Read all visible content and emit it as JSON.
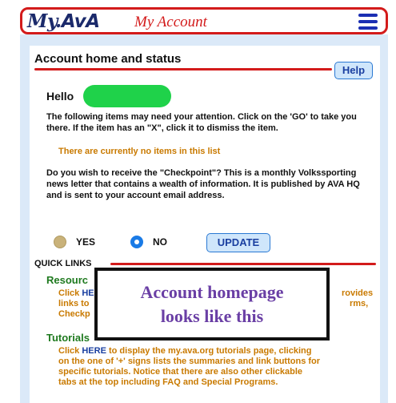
{
  "header": {
    "logo_my": "My.",
    "logo_ava": "AvA",
    "title": "My Account"
  },
  "account": {
    "section_title": "Account home and status",
    "help_label": "Help",
    "hello_label": "Hello",
    "attention_text": "The following items may need your attention. Click on the 'GO' to take you there. If the item has an \"X\", click it to dismiss the item.",
    "no_items_text": "There are currently no items in this list",
    "checkpoint_question": "Do you wish to receive the \"Checkpoint\"? This is a monthly Volkssporting news letter that contains a wealth of information. It is published by AVA HQ and is sent to your account email address.",
    "yes_label": "YES",
    "no_label": "NO",
    "selected_option": "NO",
    "update_label": "UPDATE"
  },
  "quick_links": {
    "title": "QUICK LINKS",
    "resources": {
      "heading": "Resourc",
      "line1_prefix": "Click",
      "line1_link": "HE",
      "line1_suffix": "rovides",
      "line2_prefix": "links to",
      "line2_suffix": "rms,",
      "line3_prefix": "Checkp"
    },
    "tutorials": {
      "heading": "Tutorials",
      "line1_prefix": "Click",
      "line1_link": "HERE",
      "line1_text": "to display the my.ava.org tutorials page, clicking",
      "line2": "on the one of '+' signs lists the summaries and link buttons for",
      "line3": "specific tutorials. Notice that there are also other clickable",
      "line4": "tabs at the top including FAQ and Special Programs."
    }
  },
  "overlay": {
    "line1": "Account homepage",
    "line2": "looks like this"
  },
  "colors": {
    "accent_red": "#d31b1b",
    "brand_navy": "#1b2a6b",
    "link_blue": "#1a3fa0",
    "orange_text": "#c97a00",
    "green_heading": "#1f7a1f",
    "overlay_purple": "#6a3fa5",
    "panel_bg": "#dbe9f8"
  }
}
